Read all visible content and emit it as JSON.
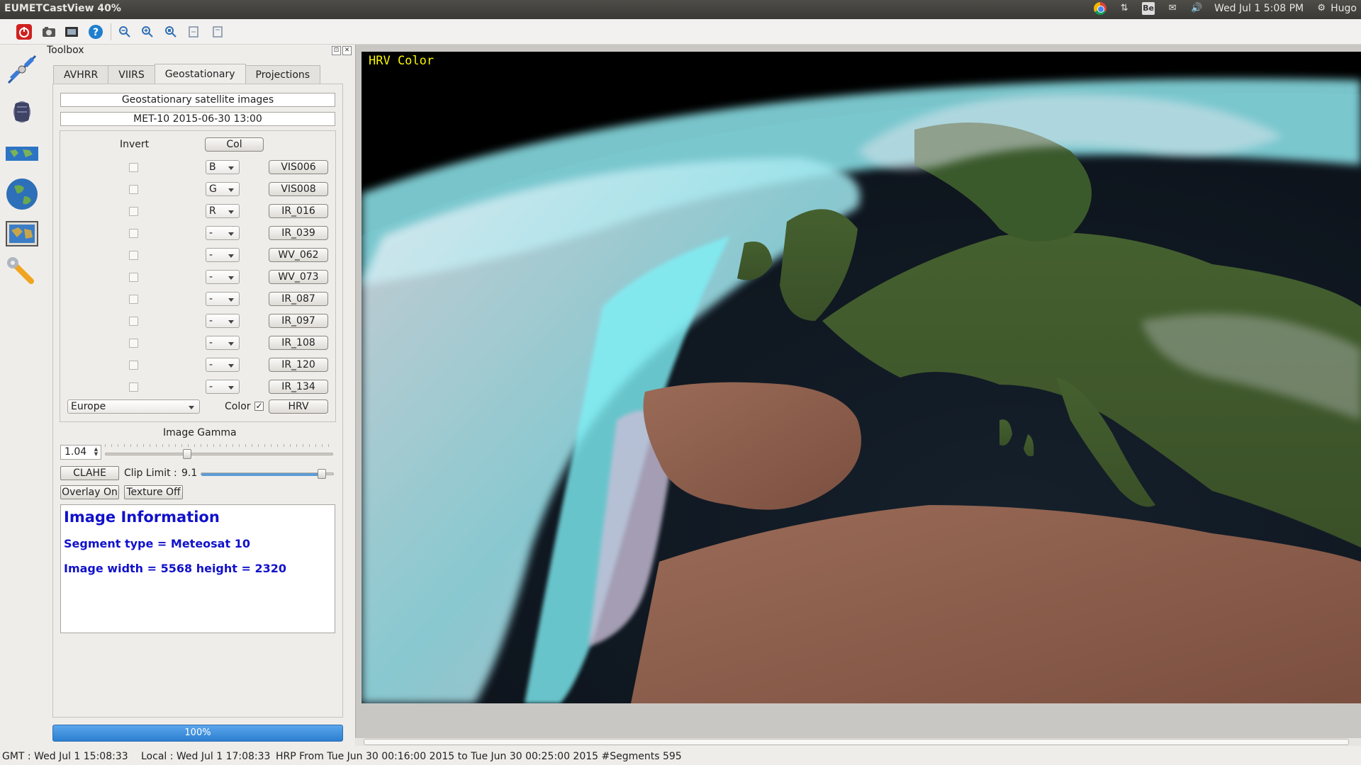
{
  "window": {
    "title": "EUMETCastView 40%"
  },
  "tray": {
    "datetime": "Wed Jul  1  5:08 PM",
    "user": "Hugo",
    "be_label": "Be"
  },
  "toolbox": {
    "title": "Toolbox",
    "tabs": [
      "AVHRR",
      "VIIRS",
      "Geostationary",
      "Projections"
    ],
    "active_tab": "Geostationary",
    "header": "Geostationary satellite images",
    "subheader": "MET-10 2015-06-30   13:00",
    "invert_label": "Invert",
    "col_button": "Col",
    "channels": [
      {
        "combo": "B",
        "name": "VIS006"
      },
      {
        "combo": "G",
        "name": "VIS008"
      },
      {
        "combo": "R",
        "name": "IR_016"
      },
      {
        "combo": "-",
        "name": "IR_039"
      },
      {
        "combo": "-",
        "name": "WV_062"
      },
      {
        "combo": "-",
        "name": "WV_073"
      },
      {
        "combo": "-",
        "name": "IR_087"
      },
      {
        "combo": "-",
        "name": "IR_097"
      },
      {
        "combo": "-",
        "name": "IR_108"
      },
      {
        "combo": "-",
        "name": "IR_120"
      },
      {
        "combo": "-",
        "name": "IR_134"
      }
    ],
    "region": "Europe",
    "color_label": "Color",
    "color_checked": true,
    "hrv_button": "HRV",
    "gamma_label": "Image Gamma",
    "gamma_value": "1.04",
    "gamma_slider_fraction": 0.36,
    "clahe_button": "CLAHE",
    "clip_label": "Clip Limit :",
    "clip_value": "9.1",
    "clip_slider_fraction": 0.91,
    "overlay_button": "Overlay On",
    "texture_button": "Texture Off",
    "info": {
      "heading": "Image Information",
      "line1": "Segment type = Meteosat 10",
      "line2": "Image width = 5568 height = 2320"
    },
    "progress": "100%",
    "progress_fraction": 1.0
  },
  "image": {
    "label": "HRV Color",
    "label_color": "#f5f500"
  },
  "status": {
    "gmt": "GMT : Wed Jul  1 15:08:33",
    "local": "Local : Wed Jul  1 17:08:33",
    "hrp": "HRP From Tue Jun 30 00:16:00 2015 to Tue Jun 30 00:25:00 2015  #Segments 595"
  }
}
